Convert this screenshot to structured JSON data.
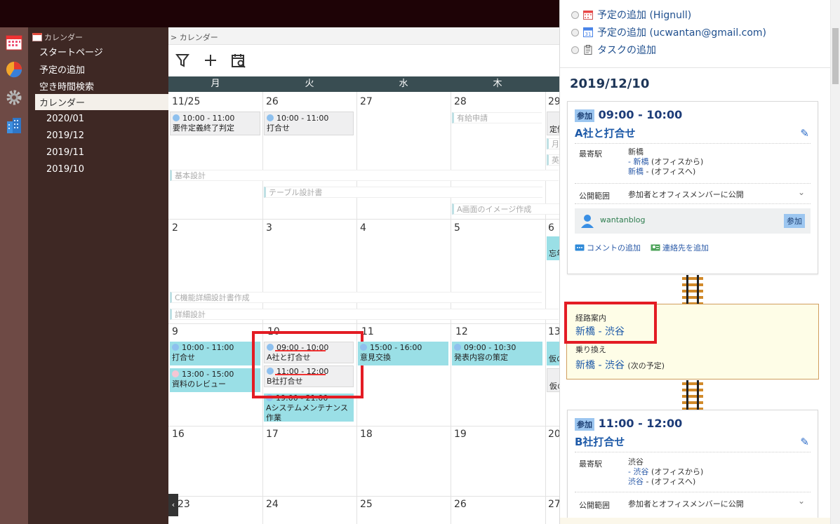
{
  "sidebar": {
    "header": "カレンダー",
    "items": [
      {
        "label": "スタートページ"
      },
      {
        "label": "予定の追加"
      },
      {
        "label": "空き時間検索"
      },
      {
        "label": "カレンダー"
      },
      {
        "label": "2020/01"
      },
      {
        "label": "2019/12"
      },
      {
        "label": "2019/11"
      },
      {
        "label": "2019/10"
      }
    ]
  },
  "breadcrumb": "> カレンダー",
  "calendar": {
    "weekdays": [
      "月",
      "火",
      "水",
      "木"
    ],
    "dates": [
      "11/25",
      "26",
      "27",
      "28",
      "29",
      "2",
      "3",
      "4",
      "5",
      "6",
      "9",
      "10",
      "11",
      "12",
      "13",
      "16",
      "17",
      "18",
      "19",
      "20",
      "23",
      "24",
      "25",
      "26",
      "27"
    ],
    "events": [
      {
        "time": "10:00 - 11:00",
        "title": "要件定義終了判定"
      },
      {
        "time": "10:00 - 11:00",
        "title": "打合せ"
      },
      {
        "title": "有給申請"
      },
      {
        "title": "定例"
      },
      {
        "title": "月"
      },
      {
        "title": "英"
      },
      {
        "title": "忘年会"
      },
      {
        "time": "10:00 - 11:00",
        "title": "打合せ"
      },
      {
        "time": "13:00 - 15:00",
        "title": "資料のレビュー"
      },
      {
        "time": "09:00 - 10:00",
        "title": "A社と打合せ"
      },
      {
        "time": "11:00 - 12:00",
        "title": "B社打合せ"
      },
      {
        "time": "19:00 - 21:00",
        "title": "Aシステムメンテナンス作業"
      },
      {
        "time": "15:00 - 16:00",
        "title": "意見交換"
      },
      {
        "time": "09:00 - 10:30",
        "title": "発表内容の策定"
      },
      {
        "title": "仮の"
      },
      {
        "title": "仮の"
      }
    ],
    "bars": [
      "基本設計",
      "テーブル設計書",
      "A画面のイメージ作成",
      "C機能詳細設計書作成",
      "詳細設計"
    ]
  },
  "panel": {
    "radios": [
      "予定の追加 (Hignull)",
      "予定の追加 (ucwantan@gmail.com)",
      "タスクの追加"
    ],
    "date": "2019/12/10",
    "cards": [
      {
        "badge": "参加",
        "time": "09:00 - 10:00",
        "title": "A社と打合せ",
        "station_label": "最寄駅",
        "station": "新橋",
        "from": "- 新橋",
        "from_note": "(オフィスから)",
        "to": "新橋",
        "to_note": "- (オフィスへ)",
        "scope_label": "公開範囲",
        "scope": "参加者とオフィスメンバーに公開",
        "member": "wantanblog",
        "member_status": "参加",
        "comment_link": "コメントの追加",
        "contact_link": "連絡先を追加"
      },
      {
        "badge": "参加",
        "time": "11:00 - 12:00",
        "title": "B社打合せ",
        "station_label": "最寄駅",
        "station": "渋谷",
        "from": "- 渋谷",
        "from_note": "(オフィスから)",
        "to": "渋谷",
        "to_note": "- (オフィスへ)",
        "scope_label": "公開範囲",
        "scope": "参加者とオフィスメンバーに公開"
      }
    ],
    "route": {
      "label": "経路案内",
      "value": "新橋 - 渋谷",
      "transfer_label": "乗り換え",
      "transfer": "新橋 - 渋谷",
      "transfer_note": "(次の予定)"
    }
  },
  "colors": {
    "accent": "#1e5aa8",
    "highlight": "#e31c24",
    "event_cyan": "#9adfe6"
  }
}
